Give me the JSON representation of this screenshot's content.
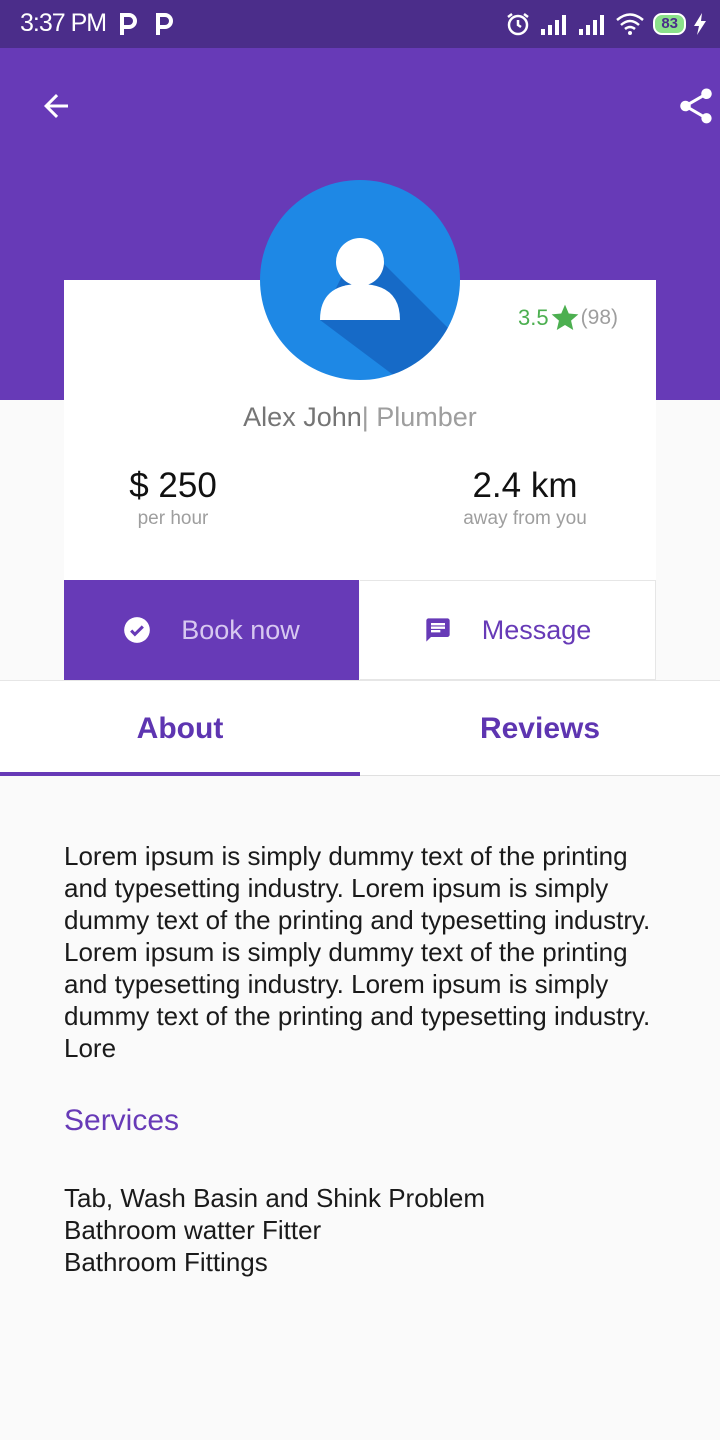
{
  "status_bar": {
    "time": "3:37 PM",
    "battery": "83",
    "icons": [
      "parking-icon",
      "parking-icon",
      "alarm-icon",
      "signal-icon",
      "signal-icon",
      "wifi-icon",
      "battery-icon",
      "charging-icon"
    ]
  },
  "header": {
    "back_icon": "arrow-back-icon",
    "share_icon": "share-icon"
  },
  "profile": {
    "rating": "3.5",
    "rating_count": "(98)",
    "name": "Alex John",
    "role": "| Plumber",
    "price": "$ 250",
    "price_unit": "per hour",
    "distance": "2.4 km",
    "distance_label": "away from you"
  },
  "actions": {
    "book_label": "Book now",
    "message_label": "Message"
  },
  "tabs": [
    {
      "label": "About",
      "selected": true
    },
    {
      "label": "Reviews",
      "selected": false
    }
  ],
  "about_text": "Lorem ipsum is simply dummy text of the printing and typesetting industry. Lorem ipsum is simply dummy text of the printing and typesetting industry. Lorem ipsum is simply dummy text of the printing and typesetting industry. Lorem ipsum is simply dummy text of the printing and typesetting industry. Lore",
  "services": {
    "title": "Services",
    "items": [
      "Tab, Wash Basin and Shink Problem",
      "Bathroom watter Fitter",
      "Bathroom Fittings"
    ]
  },
  "colors": {
    "primary": "#673ab7",
    "status_bar": "#4b2d8a",
    "avatar": "#1e88e5",
    "rating": "#4caf50"
  }
}
